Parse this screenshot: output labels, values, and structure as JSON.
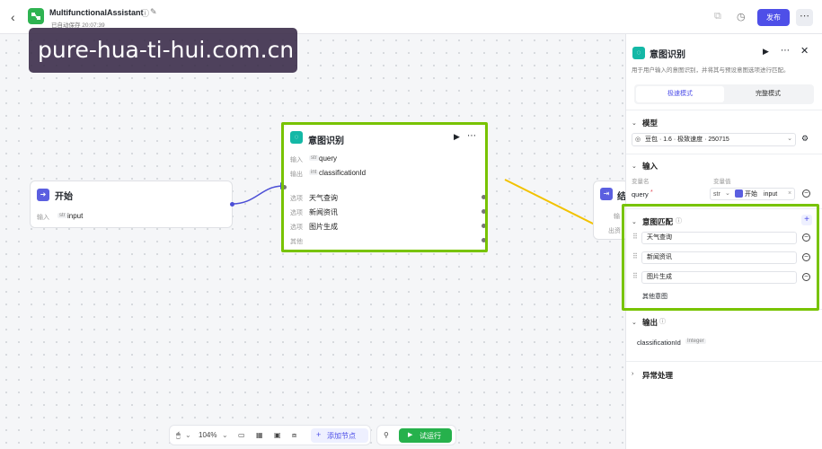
{
  "header": {
    "app_title": "MultifunctionalAssistant",
    "saved_text": "已自动保存 20:07:39",
    "publish_label": "发布"
  },
  "watermark": "pure-hua-ti-hui.com.cn",
  "start_node": {
    "title": "开始",
    "input_label": "输入",
    "input_type": "str",
    "input_name": "input"
  },
  "intent_node": {
    "title": "意图识别",
    "input_label": "输入",
    "input_type": "str",
    "input_name": "query",
    "output_label": "输出",
    "output_type": "int",
    "output_name": "classificationId",
    "options": [
      {
        "label": "选项",
        "value": "天气查询"
      },
      {
        "label": "选项",
        "value": "新闻资讯"
      },
      {
        "label": "选项",
        "value": "图片生成"
      },
      {
        "label": "其他",
        "value": ""
      }
    ]
  },
  "end_node": {
    "title_partial": "结",
    "row1_partial": "输",
    "row2_partial": "出资"
  },
  "panel": {
    "title": "意图识别",
    "description": "用于用户输入的意图识别，并将其与预设意图选项进行匹配。",
    "tabs": [
      "极速模式",
      "完整模式"
    ],
    "model_section": "模型",
    "model_value": "豆包 · 1.6 · 极致速度 · 250715",
    "input_section": "输入",
    "var_name_header": "变量名",
    "var_value_header": "变量值",
    "input_var_name": "query",
    "input_var_required": "*",
    "input_var_type": "str",
    "input_var_source_node": "开始",
    "input_var_source_field": "input",
    "intent_section": "意图匹配",
    "intents": [
      "天气查询",
      "新闻资讯",
      "图片生成"
    ],
    "other_intent": "其他意图",
    "output_section": "输出",
    "output_name": "classificationId",
    "output_type": "Integer",
    "exception_section": "异常处理"
  },
  "toolbar": {
    "zoom": "104%",
    "add_node_label": "添加节点",
    "test_run_label": "试运行"
  },
  "colors": {
    "accent": "#4e4fe8",
    "highlight": "#78c300",
    "intent_icon": "#14b8a6",
    "arrow": "#f2c200",
    "run_button": "#26b14c"
  }
}
